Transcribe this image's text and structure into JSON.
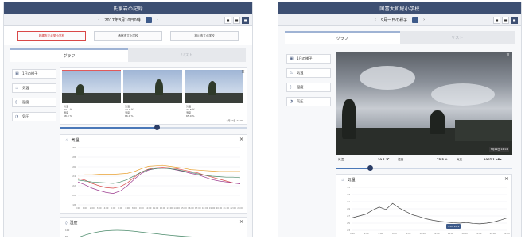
{
  "left": {
    "title": "氏家岩の記録",
    "date": "2017年8月10日0時",
    "nav_prev": "‹",
    "nav_next": "›",
    "icon_labels": [
      "■",
      "■",
      "■"
    ],
    "schools": [
      "札幌市立北栄小学校",
      "函館市立小学校",
      "旭川市立小学校"
    ],
    "tabs": [
      "グラフ",
      "リスト"
    ],
    "sidebar": [
      "1日の様子",
      "気温",
      "湿度",
      "気圧"
    ],
    "photos": [
      {
        "cap": [
          "気温",
          "24.1 ℃",
          "湿度",
          "68.0 %",
          "気圧",
          "1005.1"
        ]
      },
      {
        "cap": [
          "気温",
          "24.4 ℃",
          "湿度",
          "66.0 %",
          "気圧",
          "1005.0"
        ]
      },
      {
        "cap": [
          "気温",
          "24.8 ℃",
          "湿度",
          "65.0 %",
          "気圧",
          "1005.1"
        ]
      }
    ],
    "photo_stamp": "8月10日 13:00",
    "temp_card": {
      "title": "気温",
      "close": "×"
    },
    "humid_card": {
      "title": "湿度",
      "close": "×"
    },
    "y_ticks": [
      "30",
      "28",
      "26",
      "24",
      "22",
      "20",
      "18"
    ],
    "x_ticks": [
      "0:00",
      "1:00",
      "2:00",
      "3:00",
      "4:00",
      "5:00",
      "6:00",
      "7:00",
      "8:00",
      "9:00",
      "10:00",
      "11:00",
      "12:00",
      "13:00",
      "14:00",
      "15:00",
      "16:00",
      "17:00",
      "18:00",
      "19:00",
      "20:00",
      "21:00",
      "22:00",
      "23:00"
    ],
    "humid_y_ticks": [
      "100",
      "80"
    ]
  },
  "right": {
    "title": "国富大和総小学校",
    "date": "9月一日の様子",
    "nav_prev": "‹",
    "nav_next": "›",
    "icon_labels": [
      "■",
      "■",
      "■"
    ],
    "tabs": [
      "グラフ",
      "リスト"
    ],
    "sidebar": [
      "1日の様子",
      "気温",
      "湿度",
      "気圧"
    ],
    "photo_stamp": "7月29日 14:14",
    "measurements": [
      {
        "label": "気温",
        "value": "30.1 ℃"
      },
      {
        "label": "湿度",
        "value": "75.5 %"
      },
      {
        "label": "気圧",
        "value": "1007.1 hPa"
      }
    ],
    "temp_card": {
      "title": "気温",
      "close": "×"
    },
    "y_ticks": [
      "35",
      "33",
      "31",
      "29",
      "27",
      "25",
      "23"
    ],
    "tooltip": "7:07 28.1",
    "x_ticks": [
      "0:00",
      "2:00",
      "4:00",
      "6:00",
      "8:00",
      "10:00",
      "12:00",
      "14:00",
      "16:00",
      "18:00",
      "20:00",
      "22:00"
    ]
  },
  "chart_data": [
    {
      "type": "line",
      "title": "気温",
      "x": [
        "0",
        "1",
        "2",
        "3",
        "4",
        "5",
        "6",
        "7",
        "8",
        "9",
        "10",
        "11",
        "12",
        "13",
        "14",
        "15",
        "16",
        "17",
        "18",
        "19",
        "20",
        "21",
        "22",
        "23"
      ],
      "series": [
        {
          "color": "#e8a030",
          "values": [
            24.2,
            24.3,
            24.3,
            24.4,
            24.4,
            24.4,
            24.5,
            24.6,
            25.0,
            25.6,
            26.1,
            26.2,
            26.3,
            26.1,
            25.9,
            25.7,
            25.4,
            25.3,
            25.2,
            25.1,
            25.0,
            25.0,
            25.0,
            25.0
          ]
        },
        {
          "color": "#d94a4a",
          "values": [
            23.5,
            23.2,
            22.5,
            22.0,
            21.6,
            21.5,
            21.8,
            22.6,
            23.8,
            24.9,
            25.5,
            25.8,
            25.9,
            25.8,
            25.6,
            25.3,
            25.0,
            24.7,
            24.2,
            23.8,
            23.4,
            23.0,
            22.6,
            22.5
          ]
        },
        {
          "color": "#9b3a8e",
          "values": [
            22.8,
            22.2,
            21.5,
            21.0,
            20.6,
            20.4,
            20.9,
            22.0,
            23.4,
            24.6,
            25.3,
            25.6,
            25.7,
            25.6,
            25.3,
            25.0,
            24.6,
            24.3,
            23.8,
            23.3,
            23.0,
            22.8,
            22.6,
            22.4
          ]
        },
        {
          "color": "#4a8a6a",
          "values": [
            23.2,
            23.0,
            22.8,
            22.7,
            22.6,
            22.5,
            22.8,
            23.3,
            24.1,
            24.9,
            25.4,
            25.6,
            25.7,
            25.6,
            25.4,
            25.1,
            24.8,
            24.5,
            24.2,
            24.0,
            23.9,
            23.8,
            23.8,
            23.7
          ]
        }
      ],
      "ylim": [
        18,
        30
      ]
    },
    {
      "type": "line",
      "title": "気温",
      "x": [
        "0",
        "1",
        "2",
        "3",
        "4",
        "5",
        "6",
        "7",
        "8",
        "9",
        "10",
        "11",
        "12",
        "13",
        "14",
        "15",
        "16",
        "17",
        "18",
        "19",
        "20",
        "21",
        "22",
        "23"
      ],
      "series": [
        {
          "color": "#444444",
          "values": [
            26.5,
            27.0,
            27.5,
            28.6,
            29.5,
            28.8,
            30.5,
            29.2,
            28.2,
            27.3,
            26.8,
            26.2,
            25.8,
            25.5,
            25.3,
            25.1,
            25.0,
            25.2,
            24.9,
            24.8,
            25.0,
            25.3,
            25.8,
            26.4
          ]
        }
      ],
      "ylim": [
        23,
        35
      ]
    }
  ]
}
